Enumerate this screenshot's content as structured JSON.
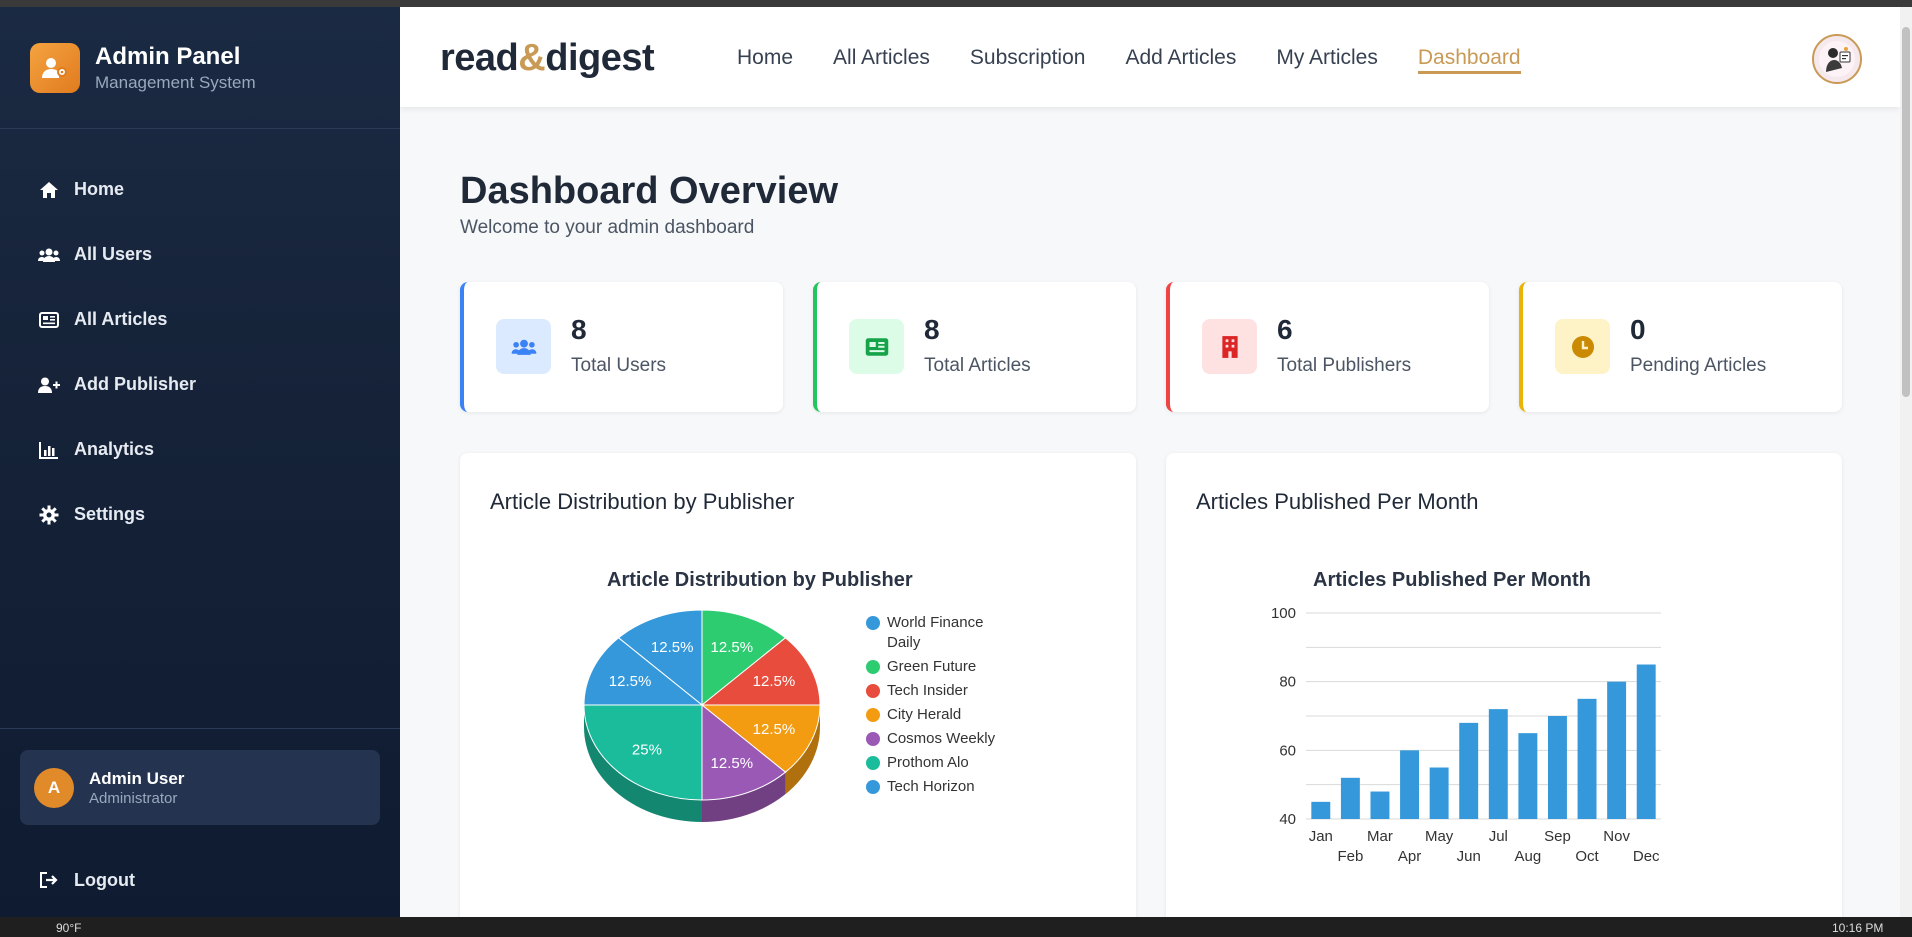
{
  "sidebar": {
    "brand_title": "Admin Panel",
    "brand_subtitle": "Management System",
    "items": [
      {
        "label": "Home",
        "icon": "home-icon"
      },
      {
        "label": "All Users",
        "icon": "users-icon"
      },
      {
        "label": "All Articles",
        "icon": "newspaper-icon"
      },
      {
        "label": "Add Publisher",
        "icon": "user-plus-icon"
      },
      {
        "label": "Analytics",
        "icon": "bar-chart-icon"
      },
      {
        "label": "Settings",
        "icon": "gear-icon"
      }
    ],
    "user": {
      "initial": "A",
      "name": "Admin User",
      "role": "Administrator"
    },
    "logout_label": "Logout"
  },
  "header": {
    "logo_left": "read",
    "logo_amp": "&",
    "logo_right": "digest",
    "nav": [
      "Home",
      "All Articles",
      "Subscription",
      "Add Articles",
      "My Articles",
      "Dashboard"
    ],
    "active_nav": "Dashboard"
  },
  "page": {
    "title": "Dashboard Overview",
    "subtitle": "Welcome to your admin dashboard"
  },
  "stats": [
    {
      "value": "8",
      "label": "Total Users",
      "color": "#3b82f6",
      "icon": "users-icon"
    },
    {
      "value": "8",
      "label": "Total Articles",
      "color": "#22c55e",
      "icon": "newspaper-icon"
    },
    {
      "value": "6",
      "label": "Total Publishers",
      "color": "#ef4444",
      "icon": "building-icon"
    },
    {
      "value": "0",
      "label": "Pending Articles",
      "color": "#eab308",
      "icon": "clock-icon"
    }
  ],
  "cards": {
    "pie_card_title": "Article Distribution by Publisher",
    "bar_card_title": "Articles Published Per Month"
  },
  "chart_data": [
    {
      "type": "pie",
      "title": "Article Distribution by Publisher",
      "labels": [
        "World Finance Daily",
        "Green Future",
        "Tech Insider",
        "City Herald",
        "Cosmos Weekly",
        "Prothom Alo",
        "Tech Horizon"
      ],
      "values": [
        12.5,
        12.5,
        12.5,
        12.5,
        12.5,
        25,
        12.5
      ],
      "colors": [
        "#3498db",
        "#2ecc71",
        "#e74c3c",
        "#f39c12",
        "#9b59b6",
        "#1abc9c",
        "#3498db"
      ],
      "data_labels": [
        "12.5%",
        "12.5%",
        "12.5%",
        "12.5%",
        "12.5%",
        "25%",
        "12.5%"
      ],
      "legend": "right"
    },
    {
      "type": "bar",
      "title": "Articles Published Per Month",
      "categories": [
        "Jan",
        "Feb",
        "Mar",
        "Apr",
        "May",
        "Jun",
        "Jul",
        "Aug",
        "Sep",
        "Oct",
        "Nov",
        "Dec"
      ],
      "values": [
        45,
        52,
        48,
        60,
        55,
        68,
        72,
        65,
        70,
        75,
        80,
        85
      ],
      "ylim": [
        40,
        100
      ],
      "yticks": [
        40,
        60,
        80,
        100
      ],
      "color": "#3498db",
      "grid": true
    }
  ],
  "taskbar": {
    "weather": "90°F",
    "time": "10:16 PM"
  }
}
